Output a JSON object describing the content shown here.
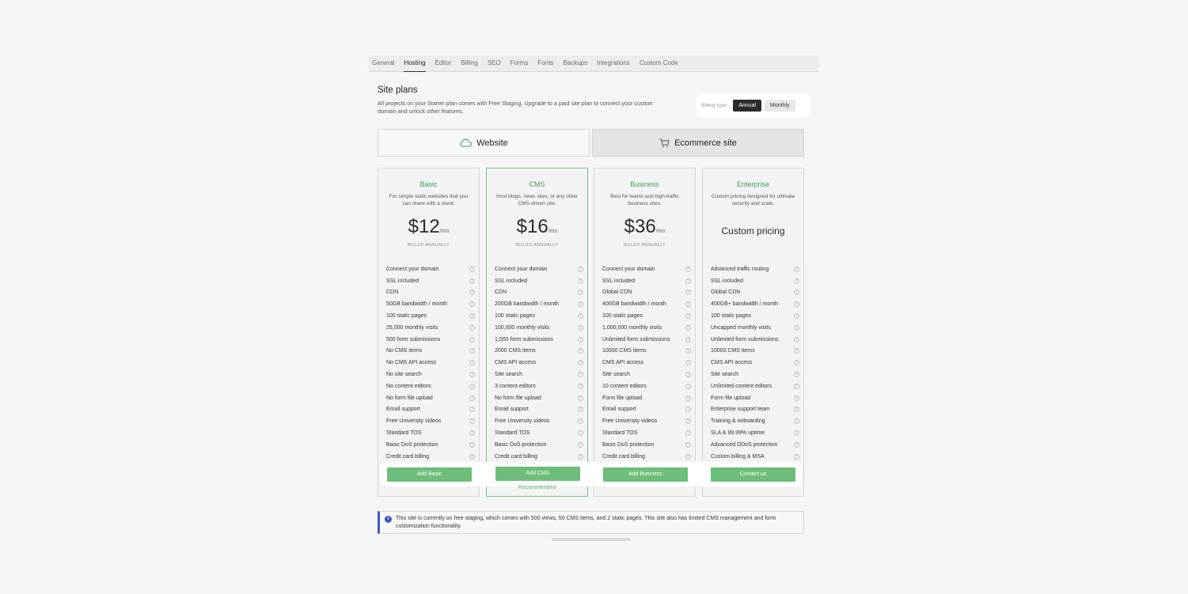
{
  "tabs": [
    "General",
    "Hosting",
    "Editor",
    "Billing",
    "SEO",
    "Forms",
    "Fonts",
    "Backups",
    "Integrations",
    "Custom Code"
  ],
  "active_tab": "Hosting",
  "page": {
    "title": "Site plans",
    "description": "All projects on your Starter plan comes with Free Staging. Upgrade to a paid site plan to connect your custom domain and unlock other features."
  },
  "billing": {
    "label": "Billing type:",
    "options": [
      "Annual",
      "Monthly"
    ],
    "selected": "Annual"
  },
  "plan_types": {
    "website": "Website",
    "ecommerce": "Ecommerce site",
    "selected": "Website"
  },
  "plans": [
    {
      "name": "Basic",
      "description": "For simple static websites that you can share with a client.",
      "price": "$12",
      "period": "/mo",
      "billed": "BILLED ANNUALLY",
      "features": [
        "Connect your domain",
        "SSL included",
        "CDN",
        "50GB bandwidth / month",
        "100 static pages",
        "25,000 monthly visits",
        "500 form submissions",
        "No CMS items",
        "No CMS API access",
        "No site search",
        "No content editors",
        "No form file upload",
        "Email support",
        "Free University videos",
        "Standard TOS",
        "Basic DoS protection",
        "Credit card billing"
      ],
      "cta": "Add Basic"
    },
    {
      "name": "CMS",
      "description": "Host blogs, news sites, or any other CMS-driven site.",
      "price": "$16",
      "period": "/mo",
      "billed": "BILLED ANNUALLY",
      "features": [
        "Connect your domain",
        "SSL included",
        "CDN",
        "200GB bandwidth / month",
        "100 static pages",
        "100,000 monthly visits",
        "1,000 form submissions",
        "2000 CMS items",
        "CMS API access",
        "Site search",
        "3 content editors",
        "No form file upload",
        "Email support",
        "Free University videos",
        "Standard TOS",
        "Basic DoS protection",
        "Credit card billing"
      ],
      "cta": "Add CMS",
      "badge": "Recommended"
    },
    {
      "name": "Business",
      "description": "Best for teams and high-traffic business sites.",
      "price": "$36",
      "period": "/mo",
      "billed": "BILLED ANNUALLY",
      "features": [
        "Connect your domain",
        "SSL included",
        "Global CDN",
        "400GB bandwidth / month",
        "100 static pages",
        "1,000,000 monthly visits",
        "Unlimited form submissions",
        "10000 CMS items",
        "CMS API access",
        "Site search",
        "10 content editors",
        "Form file upload",
        "Email support",
        "Free University videos",
        "Standard TOS",
        "Basic DoS protection",
        "Credit card billing"
      ],
      "cta": "Add Business"
    },
    {
      "name": "Enterprise",
      "description": "Custom pricing designed for ultimate security and scale.",
      "price": "Custom pricing",
      "period": "",
      "billed": "",
      "features": [
        "Advanced traffic routing",
        "SSL included",
        "Global CDN",
        "400GB+ bandwidth / month",
        "100 static pages",
        "Uncapped monthly visits",
        "Unlimited form submissions",
        "10000 CMS items",
        "CMS API access",
        "Site search",
        "Unlimited content editors",
        "Form file upload",
        "Enterprise support team",
        "Training & onboarding",
        "SLA & 99.99% uptime",
        "Advanced DDoS protection",
        "Custom billing & MSA"
      ],
      "cta": "Contact us"
    }
  ],
  "notice": {
    "text": "This site is currently on free staging, which comes with 500 views, 50 CMS items, and 2 static pages. This site also has limited CMS management and form customization functionality."
  },
  "colors": {
    "accent_green": "#6dbe7a",
    "plan_name_green": "#3e9c55",
    "notice_blue": "#3b57c4",
    "overlay": "rgba(0,0,0,0.06)"
  }
}
